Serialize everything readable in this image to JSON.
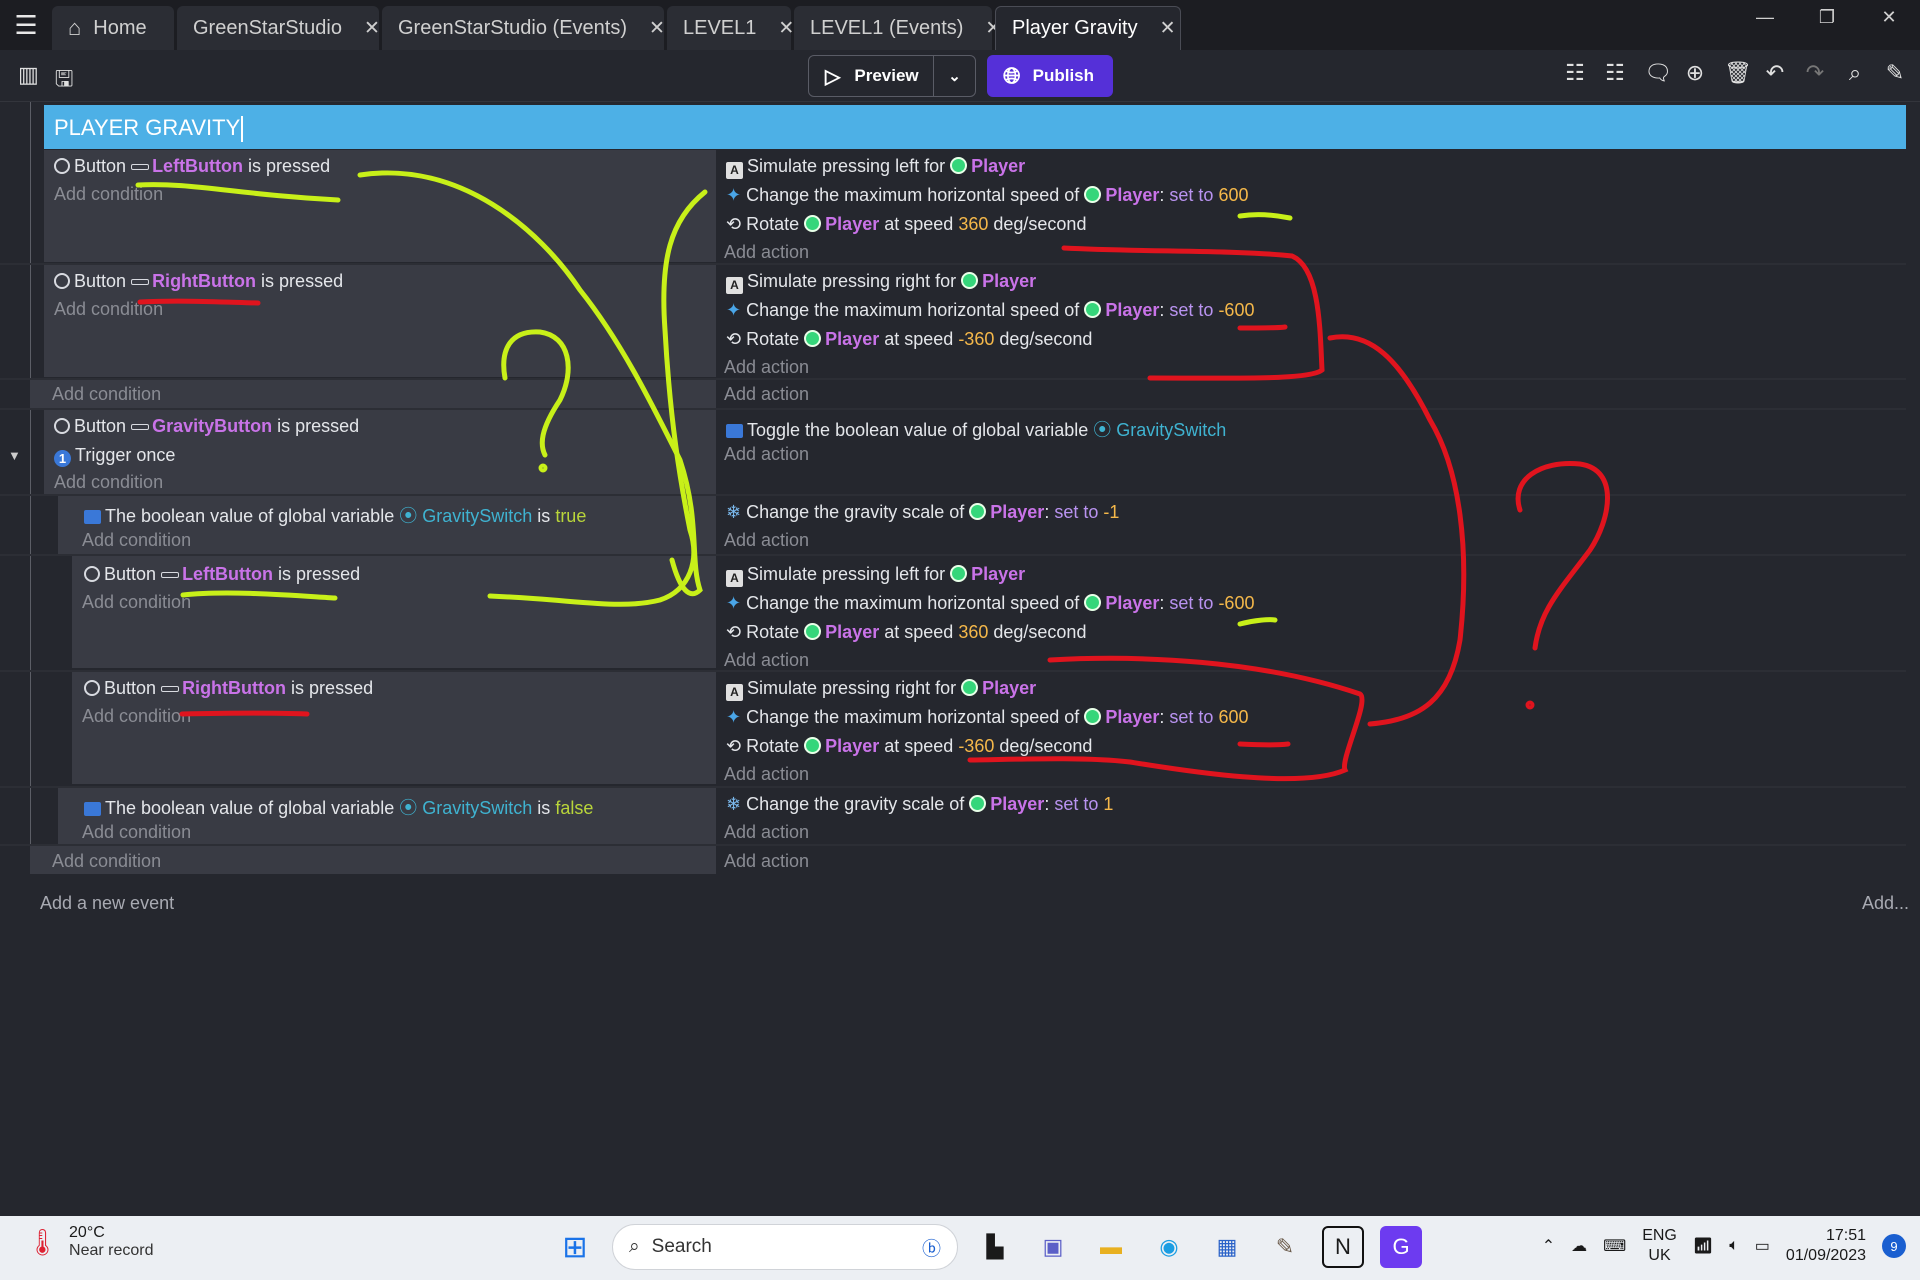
{
  "tabs": [
    {
      "label": "Home"
    },
    {
      "label": "GreenStarStudio"
    },
    {
      "label": "GreenStarStudio (Events)"
    },
    {
      "label": "LEVEL1"
    },
    {
      "label": "LEVEL1 (Events)"
    },
    {
      "label": "Player Gravity"
    }
  ],
  "toolbar": {
    "preview_label": "Preview",
    "publish_label": "Publish"
  },
  "group_title": "PLAYER GRAVITY",
  "texts": {
    "button": "Button",
    "is_pressed": "is pressed",
    "add_condition": "Add condition",
    "add_action": "Add action",
    "simulate_left": "Simulate pressing left for",
    "simulate_right": "Simulate pressing right for",
    "change_max_speed": "Change the maximum horizontal speed of",
    "rotate": "Rotate",
    "at_speed": "at speed",
    "deg_second": "deg/second",
    "set_to": "set to",
    "colon": ":",
    "toggle_bool": "Toggle the boolean value of global variable",
    "trigger_once": "Trigger once",
    "bool_value": "The boolean value of global variable",
    "is": "is",
    "change_gravity": "Change the gravity scale of",
    "add_new_event": "Add a new event",
    "add_more": "Add..."
  },
  "names": {
    "player": "Player",
    "left_button": "LeftButton",
    "right_button": "RightButton",
    "gravity_button": "GravityButton",
    "gravity_switch": "GravitySwitch",
    "true": "true",
    "false": "false"
  },
  "values": {
    "speed_600": "600",
    "speed_neg600": "-600",
    "rot_360": "360",
    "rot_neg360": "-360",
    "grav_neg1": "-1",
    "grav_1": "1"
  },
  "taskbar": {
    "temp": "20°C",
    "weather": "Near record",
    "search": "Search",
    "lang1": "ENG",
    "lang2": "UK",
    "time": "17:51",
    "date": "01/09/2023",
    "badge": "9"
  },
  "colors": {
    "accent": "#4db0e6",
    "publish": "#5530d8",
    "annot_green": "#c8f019",
    "annot_red": "#e0141e"
  }
}
